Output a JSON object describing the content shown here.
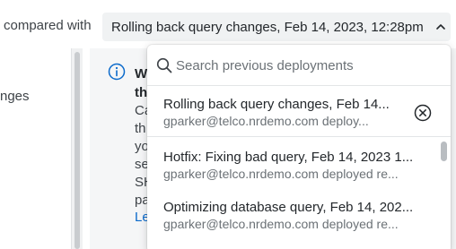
{
  "header": {
    "compare_label": "compared with",
    "selected_deployment": "Rolling back query changes, Feb 14, 2023, 12:28pm"
  },
  "left_panel": {
    "text": "nges"
  },
  "info_card": {
    "title_lines": [
      "W",
      "th"
    ],
    "body_lines": [
      "Ca",
      "th",
      "yo",
      "se",
      "SH",
      "pa"
    ],
    "link_text": "Le"
  },
  "dropdown": {
    "search_placeholder": "Search previous deployments",
    "selected": {
      "title": "Rolling back query changes, Feb 14...",
      "subtitle": "gparker@telco.nrdemo.com deploy..."
    },
    "items": [
      {
        "title": "Hotfix: Fixing bad query, Feb 14, 2023 1...",
        "subtitle": "gparker@telco.nrdemo.com deployed re..."
      },
      {
        "title": "Optimizing database query, Feb 14, 202...",
        "subtitle": "gparker@telco.nrdemo.com deployed re..."
      }
    ]
  },
  "colors": {
    "text_primary": "#23272b",
    "text_secondary": "#6b7176",
    "link": "#0b6acb",
    "select_bg": "#f0f2f3",
    "card_bg": "#f5f6f7"
  }
}
